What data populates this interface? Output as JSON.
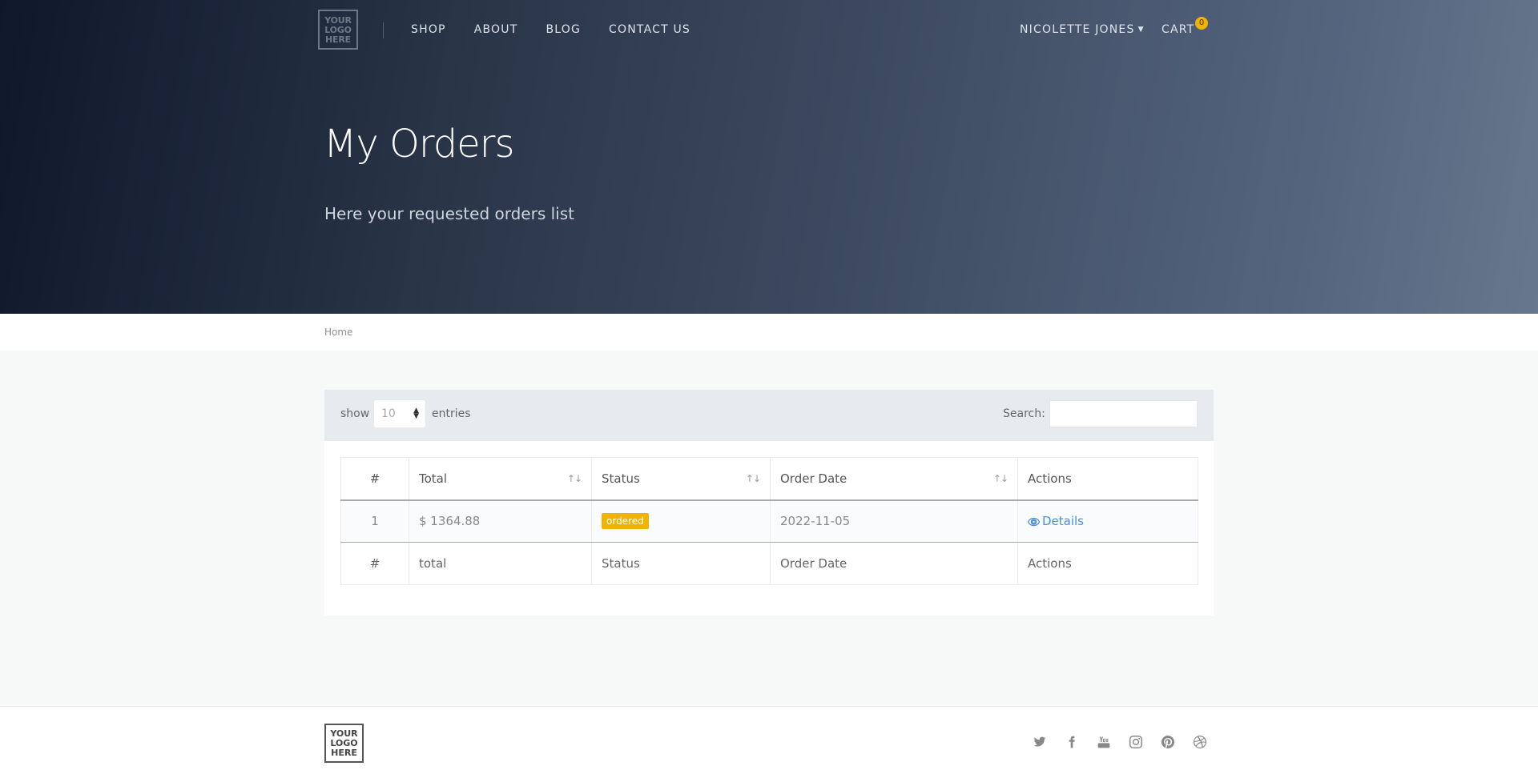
{
  "header": {
    "logo_text": "YOUR LOGO HERE",
    "nav": [
      {
        "label": "SHOP"
      },
      {
        "label": "ABOUT"
      },
      {
        "label": "BLOG"
      },
      {
        "label": "CONTACT US"
      }
    ],
    "user_name": "NICOLETTE JONES",
    "cart_label": "CART",
    "cart_count": "0"
  },
  "hero": {
    "title": "My Orders",
    "subtitle": "Here your requested orders list"
  },
  "breadcrumb": {
    "home": "Home"
  },
  "table_controls": {
    "show_label": "show",
    "entries_value": "10",
    "entries_label": "entries",
    "search_label": "Search:",
    "search_value": ""
  },
  "table": {
    "headers": [
      "#",
      "Total",
      "Status",
      "Order Date",
      "Actions"
    ],
    "rows": [
      {
        "num": "1",
        "total": "$ 1364.88",
        "status": "ordered",
        "date": "2022-11-05",
        "action": "Details"
      }
    ],
    "footer": [
      "#",
      "total",
      "Status",
      "Order Date",
      "Actions"
    ]
  },
  "footer": {
    "logo_text": "YOUR LOGO HERE",
    "socials": [
      "twitter-icon",
      "facebook-icon",
      "youtube-icon",
      "instagram-icon",
      "pinterest-icon",
      "dribbble-icon"
    ]
  },
  "colors": {
    "accent": "#f0b400",
    "link": "#4a8fdd",
    "hero_dark": "#0f172b",
    "hero_light": "#67778d"
  }
}
